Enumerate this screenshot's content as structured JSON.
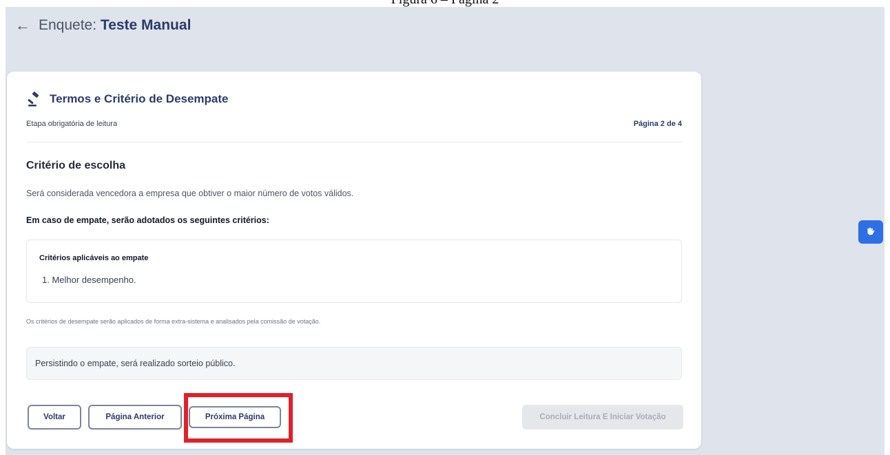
{
  "caption": "Figura 6 – Página 2",
  "header": {
    "prefix": "Enquete:",
    "name": "Teste Manual"
  },
  "card": {
    "title": "Termos e Critério de Desempate",
    "subtitle": "Etapa obrigatória de leitura",
    "page_indicator": "Página 2 de 4",
    "section_title": "Critério de escolha",
    "paragraph": "Será considerada vencedora a empresa que obtiver o maior número de votos válidos.",
    "paragraph_bold": "Em caso de empate, serão adotados os seguintes critérios:",
    "criteria_box": {
      "title": "Critérios aplicáveis ao empate",
      "items": [
        "1. Melhor desempenho."
      ]
    },
    "footnote": "Os critérios de desempate serão aplicados de forma extra-sistema e analisados pela comissão de votação.",
    "notice": "Persistindo o empate, será realizado sorteio público."
  },
  "buttons": {
    "back": "Voltar",
    "previous": "Página Anterior",
    "next": "Próxima Página",
    "finish": "Concluir Leitura E Iniciar Votação"
  },
  "colors": {
    "accent": "#2b3a6b",
    "highlight": "#e0202a",
    "a11y_button": "#2f6fe4",
    "background": "#dfe3ec"
  },
  "icons": {
    "back": "arrow-left-icon",
    "title": "gavel-icon",
    "accessibility": "sign-language-icon"
  }
}
